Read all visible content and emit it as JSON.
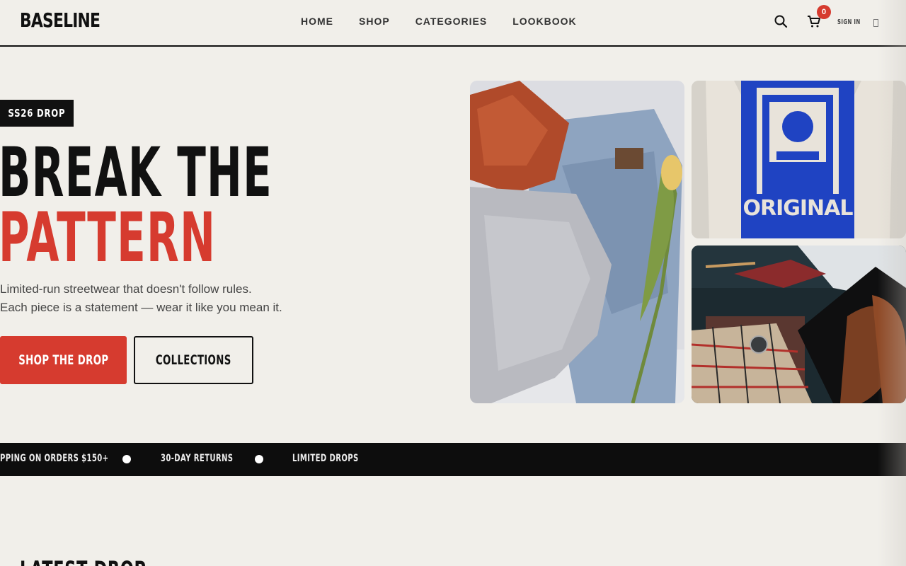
{
  "header": {
    "logo": "BASELINE",
    "nav": [
      "HOME",
      "SHOP",
      "CATEGORIES",
      "LOOKBOOK"
    ],
    "cart_count": "0",
    "signin_label": "SIGN IN",
    "icons": [
      "search-icon",
      "cart-icon",
      "menu-icon"
    ]
  },
  "hero": {
    "badge": "SS26 DROP",
    "headline_line1": "BREAK THE",
    "headline_line2": "PATTERN",
    "subtitle_line1": "Limited-run streetwear that doesn't follow rules.",
    "subtitle_line2": "Each piece is a statement — wear it like you mean it.",
    "primary_cta": "SHOP THE DROP",
    "secondary_cta": "COLLECTIONS",
    "images": [
      "knitwear-jeans-flatlay-photo",
      "original-graphic-tee-photo",
      "menswear-suitcase-photo"
    ],
    "tee_print_text": "ORIGINAL"
  },
  "ticker": {
    "items": [
      "PPING ON ORDERS $150+",
      "30-DAY RETURNS",
      "LIMITED DROPS"
    ]
  },
  "latest": {
    "title": "LATEST DROP"
  },
  "colors": {
    "background": "#f1efea",
    "accent": "#d63b2f",
    "dark": "#0d0d0d",
    "tee_print": "#1f43c2"
  }
}
